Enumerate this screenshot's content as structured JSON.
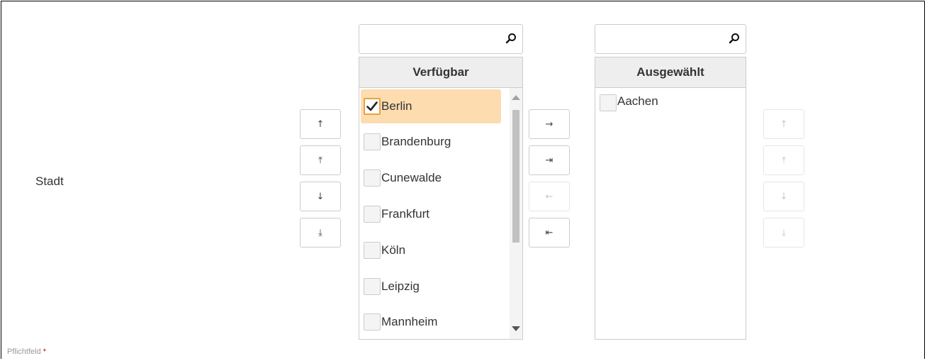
{
  "field": {
    "label": "Stadt",
    "required_note": "Pflichtfeld",
    "required_mark": "*"
  },
  "available": {
    "header": "Verfügbar",
    "search_placeholder": "",
    "search_icon": "magnifier-icon",
    "items": [
      {
        "label": "Berlin",
        "checked": true
      },
      {
        "label": "Brandenburg",
        "checked": false
      },
      {
        "label": "Cunewalde",
        "checked": false
      },
      {
        "label": "Frankfurt",
        "checked": false
      },
      {
        "label": "Köln",
        "checked": false
      },
      {
        "label": "Leipzig",
        "checked": false
      },
      {
        "label": "Mannheim",
        "checked": false
      }
    ]
  },
  "selected": {
    "header": "Ausgewählt",
    "search_placeholder": "",
    "search_icon": "magnifier-icon",
    "items": [
      {
        "label": "Aachen",
        "checked": false
      }
    ]
  },
  "left_order_buttons": {
    "up": "↑",
    "top": "⤒",
    "down": "↓",
    "bottom": "⤓"
  },
  "transfer_buttons": {
    "move_right": "→",
    "move_all_right": "⇥",
    "move_left": "←",
    "move_all_left": "⇤"
  },
  "right_order_buttons": {
    "up": "↑",
    "top": "⤒",
    "down": "↓",
    "bottom": "⤓"
  },
  "colors": {
    "selected_row": "#fddcb0",
    "check_accent": "#e8a33d",
    "header_bg": "#eeeeee",
    "required_mark": "#cc0000"
  }
}
